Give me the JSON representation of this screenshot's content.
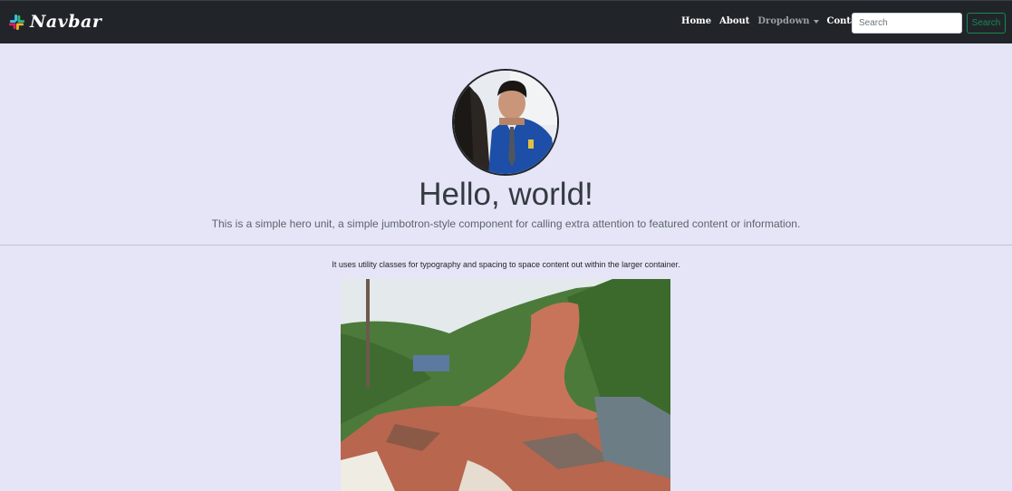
{
  "navbar": {
    "brand": "Navbar",
    "links": [
      {
        "label": "Home"
      },
      {
        "label": "About"
      },
      {
        "label": "Dropdown"
      },
      {
        "label": "Contact"
      }
    ],
    "search": {
      "placeholder": "Search",
      "value": "",
      "button_label": "Search"
    }
  },
  "hero": {
    "title": "Hello, world!",
    "lead": "This is a simple hero unit, a simple jumbotron-style component for calling extra attention to featured content or information."
  },
  "content": {
    "text": "It uses utility classes for typography and spacing to space content out within the larger container."
  },
  "colors": {
    "navbar_bg": "#212529",
    "page_bg": "#e5e5f7",
    "search_button": "#198754"
  },
  "icons": {
    "brand_logo": "slack-logo-icon",
    "dropdown_caret": "caret-down-icon"
  }
}
